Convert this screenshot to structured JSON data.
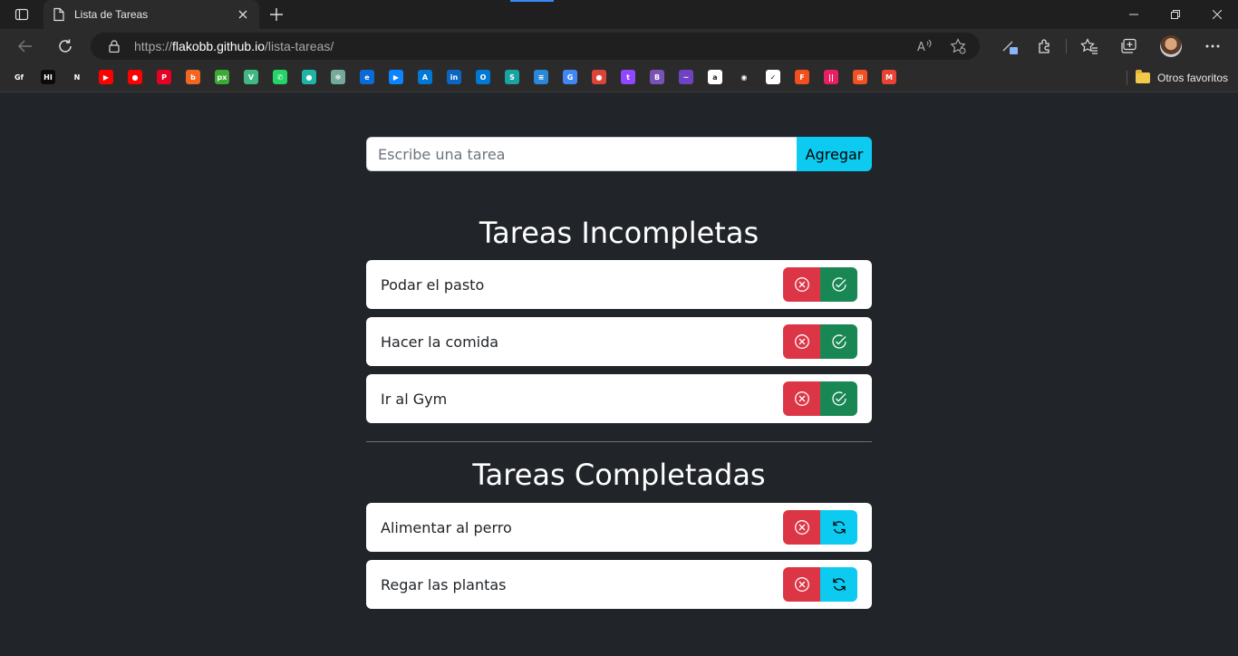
{
  "browser": {
    "tab_title": "Lista de Tareas",
    "url_prefix": "https://",
    "url_host": "flakobb.github.io",
    "url_path": "/lista-tareas/",
    "bookmarks_folder": "Otros favoritos",
    "bookmarks": [
      {
        "name": "gf",
        "color": "#2b2b2b",
        "glyph": "Gf"
      },
      {
        "name": "hi",
        "color": "#0b0b0b",
        "glyph": "HI"
      },
      {
        "name": "netflix",
        "color": "#2b2b2b",
        "glyph": "N"
      },
      {
        "name": "youtube",
        "color": "#ff0000",
        "glyph": "▶"
      },
      {
        "name": "youtube-music",
        "color": "#ff0000",
        "glyph": "●"
      },
      {
        "name": "pinterest",
        "color": "#e60023",
        "glyph": "P"
      },
      {
        "name": "b-orange",
        "color": "#f26522",
        "glyph": "b"
      },
      {
        "name": "px",
        "color": "#3aaa35",
        "glyph": "px"
      },
      {
        "name": "vue",
        "color": "#41b883",
        "glyph": "V"
      },
      {
        "name": "whatsapp",
        "color": "#25d366",
        "glyph": "✆"
      },
      {
        "name": "chat",
        "color": "#1fb5a6",
        "glyph": "●"
      },
      {
        "name": "chatgpt",
        "color": "#74aa9c",
        "glyph": "✻"
      },
      {
        "name": "edge",
        "color": "#0a6bd6",
        "glyph": "e"
      },
      {
        "name": "play",
        "color": "#0a84ff",
        "glyph": "▶"
      },
      {
        "name": "azure",
        "color": "#0078d4",
        "glyph": "A"
      },
      {
        "name": "linkedin",
        "color": "#0a66c2",
        "glyph": "in"
      },
      {
        "name": "outlook",
        "color": "#0078d4",
        "glyph": "O"
      },
      {
        "name": "s-teal",
        "color": "#1aa3a3",
        "glyph": "S"
      },
      {
        "name": "notes",
        "color": "#2b88d8",
        "glyph": "≡"
      },
      {
        "name": "translate",
        "color": "#4285f4",
        "glyph": "G"
      },
      {
        "name": "google-circle",
        "color": "#db4437",
        "glyph": "●"
      },
      {
        "name": "twitch",
        "color": "#9146ff",
        "glyph": "t"
      },
      {
        "name": "bootstrap",
        "color": "#7952b3",
        "glyph": "B"
      },
      {
        "name": "wave",
        "color": "#6f42c1",
        "glyph": "~"
      },
      {
        "name": "amazon",
        "color": "#ffffff",
        "glyph": "a"
      },
      {
        "name": "github",
        "color": "#2b2b2b",
        "glyph": "◉"
      },
      {
        "name": "doc",
        "color": "#ffffff",
        "glyph": "✓"
      },
      {
        "name": "figma",
        "color": "#f24e1e",
        "glyph": "F"
      },
      {
        "name": "rainbow",
        "color": "#e91e63",
        "glyph": "||"
      },
      {
        "name": "microsoft",
        "color": "#f25022",
        "glyph": "⊞"
      },
      {
        "name": "gmail",
        "color": "#ea4335",
        "glyph": "M"
      }
    ]
  },
  "form": {
    "placeholder": "Escribe una tarea",
    "add_label": "Agregar"
  },
  "incomplete": {
    "title": "Tareas Incompletas",
    "tasks": [
      "Podar el pasto",
      "Hacer la comida",
      "Ir al Gym"
    ]
  },
  "complete": {
    "title": "Tareas Completadas",
    "tasks": [
      "Alimentar al perro",
      "Regar las plantas"
    ]
  },
  "colors": {
    "background": "#212529",
    "danger": "#dc3545",
    "success": "#198754",
    "info": "#0dcaf0"
  }
}
